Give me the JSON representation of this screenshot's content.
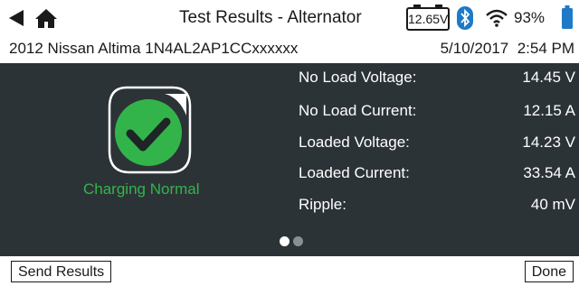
{
  "header": {
    "title": "Test Results - Alternator",
    "battery_voltage": "12.65V",
    "battery_percent": "93%",
    "icons": [
      "back-arrow-icon",
      "home-icon",
      "battery-voltage-icon",
      "bluetooth-icon",
      "wifi-icon",
      "battery-icon"
    ]
  },
  "vehicle": {
    "description": "2012 Nissan Altima 1N4AL2AP1CCxxxxxx",
    "date": "5/10/2017",
    "time": "2:54 PM"
  },
  "status": {
    "text": "Charging Normal",
    "icon": "check-badge-icon",
    "color": "#33b44a"
  },
  "results": [
    {
      "label": "No Load Voltage:",
      "value": "14.45 V"
    },
    {
      "label": "No Load Current:",
      "value": "12.15 A"
    },
    {
      "label": "Loaded Voltage:",
      "value": "14.23 V"
    },
    {
      "label": "Loaded Current:",
      "value": "33.54 A"
    },
    {
      "label": "Ripple:",
      "value": "40 mV"
    }
  ],
  "pagination": {
    "current_page": 1,
    "total_pages": 2
  },
  "footer": {
    "send_label": "Send Results",
    "done_label": "Done"
  },
  "colors": {
    "background": "#2c3337",
    "bar": "#ffffff",
    "status_green": "#33b44a",
    "bluetooth_blue": "#1e7ac8"
  }
}
